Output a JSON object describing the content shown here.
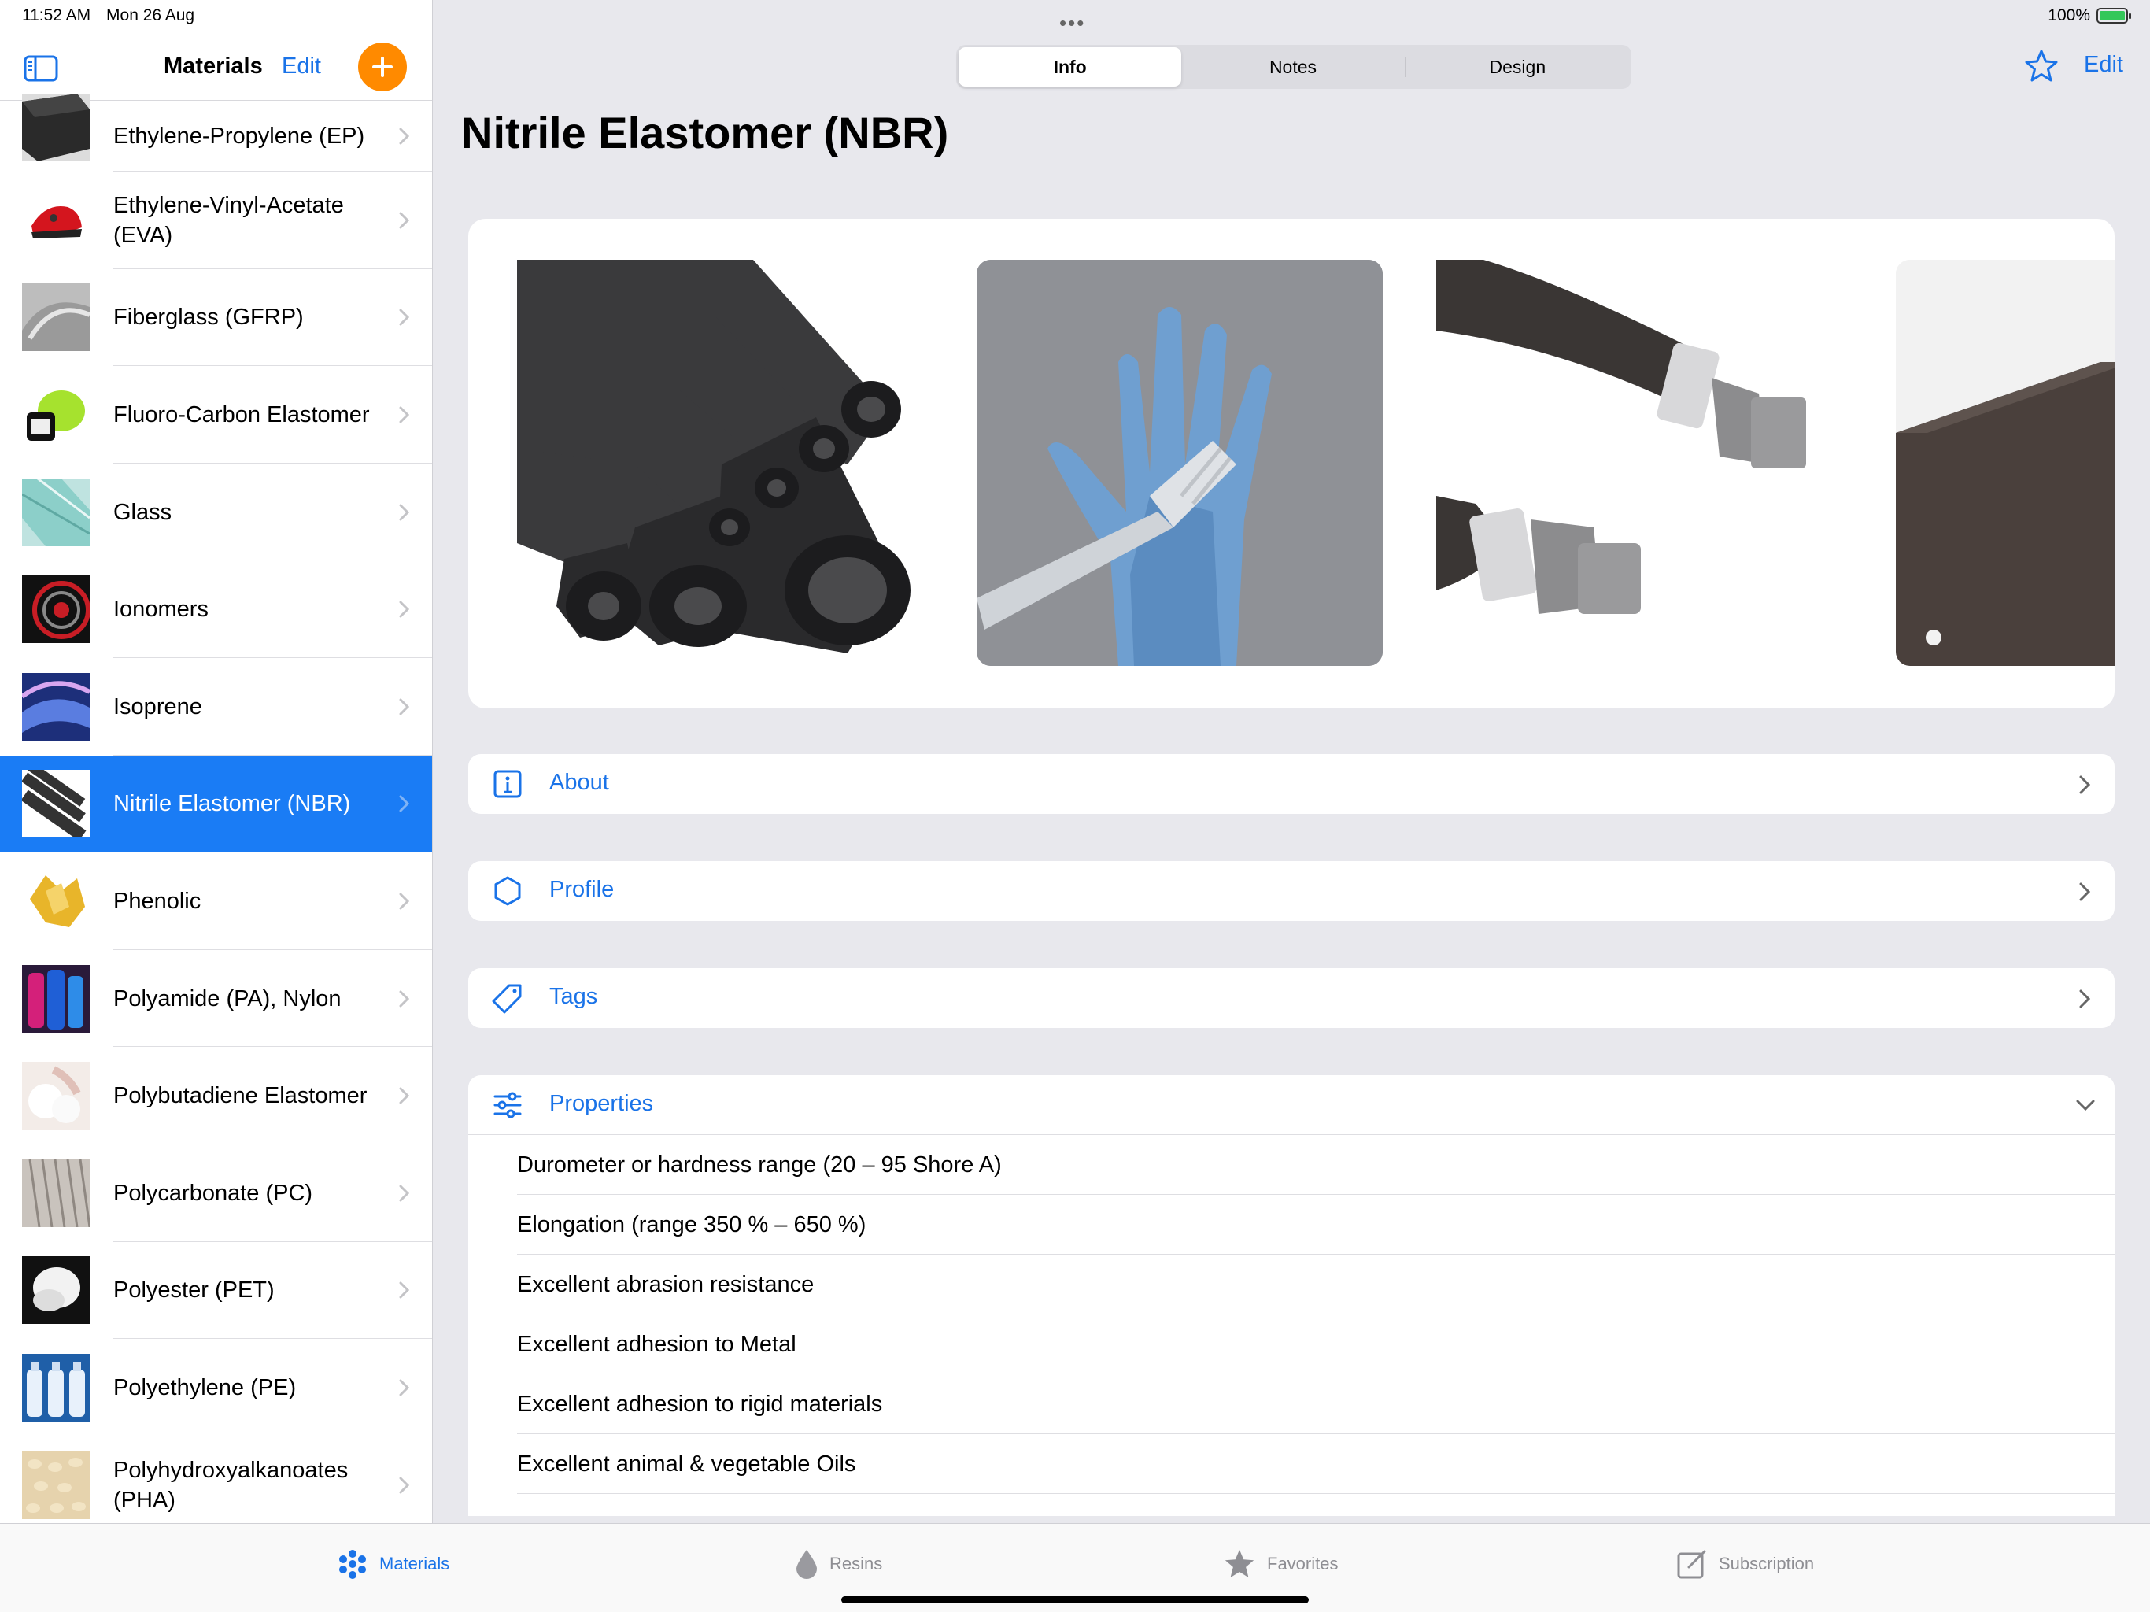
{
  "status": {
    "time": "11:52 AM",
    "date": "Mon 26 Aug",
    "battery": "100%"
  },
  "sidebar": {
    "title": "Materials",
    "edit_label": "Edit",
    "items": [
      {
        "label": "Ethylene-Propylene (EP)"
      },
      {
        "label": "Ethylene-Vinyl-Acetate (EVA)"
      },
      {
        "label": "Fiberglass (GFRP)"
      },
      {
        "label": "Fluoro-Carbon Elastomer"
      },
      {
        "label": "Glass"
      },
      {
        "label": "Ionomers"
      },
      {
        "label": "Isoprene"
      },
      {
        "label": "Nitrile Elastomer (NBR)"
      },
      {
        "label": "Phenolic"
      },
      {
        "label": "Polyamide (PA), Nylon"
      },
      {
        "label": "Polybutadiene Elastomer"
      },
      {
        "label": "Polycarbonate (PC)"
      },
      {
        "label": "Polyester (PET)"
      },
      {
        "label": "Polyethylene (PE)"
      },
      {
        "label": "Polyhydroxyalkanoates (PHA)"
      }
    ],
    "selected_index": 7
  },
  "tabs": [
    {
      "label": "Info"
    },
    {
      "label": "Notes"
    },
    {
      "label": "Design"
    }
  ],
  "active_tab": "Info",
  "main": {
    "edit_label": "Edit",
    "title": "Nitrile Elastomer (NBR)",
    "sections": [
      {
        "label": "About",
        "icon": "info-icon"
      },
      {
        "label": "Profile",
        "icon": "hexagon-icon"
      },
      {
        "label": "Tags",
        "icon": "tag-icon"
      }
    ],
    "properties": {
      "label": "Properties",
      "items": [
        "Durometer or hardness range (20 – 95 Shore A)",
        "Elongation (range 350 % – 650 %)",
        "Excellent abrasion resistance",
        "Excellent adhesion to Metal",
        "Excellent adhesion to rigid materials",
        "Excellent animal & vegetable Oils"
      ]
    }
  },
  "tabbar": [
    {
      "label": "Materials",
      "icon": "dots-icon"
    },
    {
      "label": "Resins",
      "icon": "drop-icon"
    },
    {
      "label": "Favorites",
      "icon": "star-icon"
    },
    {
      "label": "Subscription",
      "icon": "compose-icon"
    }
  ],
  "colors": {
    "accent": "#1a73e8",
    "selected": "#1a7cf5",
    "add_button": "#ff8a00",
    "background": "#e8e8ed"
  }
}
